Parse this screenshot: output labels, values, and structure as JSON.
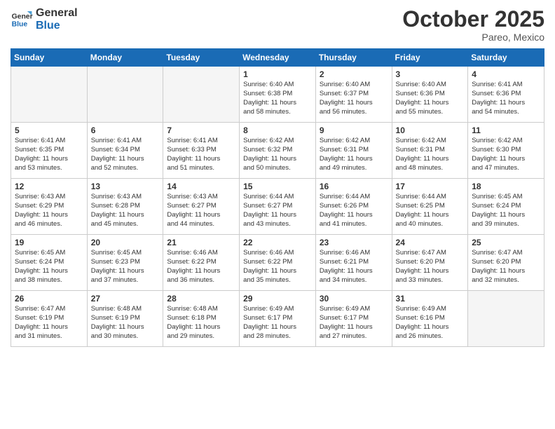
{
  "header": {
    "logo_general": "General",
    "logo_blue": "Blue",
    "month_title": "October 2025",
    "location": "Pareo, Mexico"
  },
  "weekdays": [
    "Sunday",
    "Monday",
    "Tuesday",
    "Wednesday",
    "Thursday",
    "Friday",
    "Saturday"
  ],
  "weeks": [
    [
      {
        "day": "",
        "info": ""
      },
      {
        "day": "",
        "info": ""
      },
      {
        "day": "",
        "info": ""
      },
      {
        "day": "1",
        "info": "Sunrise: 6:40 AM\nSunset: 6:38 PM\nDaylight: 11 hours\nand 58 minutes."
      },
      {
        "day": "2",
        "info": "Sunrise: 6:40 AM\nSunset: 6:37 PM\nDaylight: 11 hours\nand 56 minutes."
      },
      {
        "day": "3",
        "info": "Sunrise: 6:40 AM\nSunset: 6:36 PM\nDaylight: 11 hours\nand 55 minutes."
      },
      {
        "day": "4",
        "info": "Sunrise: 6:41 AM\nSunset: 6:36 PM\nDaylight: 11 hours\nand 54 minutes."
      }
    ],
    [
      {
        "day": "5",
        "info": "Sunrise: 6:41 AM\nSunset: 6:35 PM\nDaylight: 11 hours\nand 53 minutes."
      },
      {
        "day": "6",
        "info": "Sunrise: 6:41 AM\nSunset: 6:34 PM\nDaylight: 11 hours\nand 52 minutes."
      },
      {
        "day": "7",
        "info": "Sunrise: 6:41 AM\nSunset: 6:33 PM\nDaylight: 11 hours\nand 51 minutes."
      },
      {
        "day": "8",
        "info": "Sunrise: 6:42 AM\nSunset: 6:32 PM\nDaylight: 11 hours\nand 50 minutes."
      },
      {
        "day": "9",
        "info": "Sunrise: 6:42 AM\nSunset: 6:31 PM\nDaylight: 11 hours\nand 49 minutes."
      },
      {
        "day": "10",
        "info": "Sunrise: 6:42 AM\nSunset: 6:31 PM\nDaylight: 11 hours\nand 48 minutes."
      },
      {
        "day": "11",
        "info": "Sunrise: 6:42 AM\nSunset: 6:30 PM\nDaylight: 11 hours\nand 47 minutes."
      }
    ],
    [
      {
        "day": "12",
        "info": "Sunrise: 6:43 AM\nSunset: 6:29 PM\nDaylight: 11 hours\nand 46 minutes."
      },
      {
        "day": "13",
        "info": "Sunrise: 6:43 AM\nSunset: 6:28 PM\nDaylight: 11 hours\nand 45 minutes."
      },
      {
        "day": "14",
        "info": "Sunrise: 6:43 AM\nSunset: 6:27 PM\nDaylight: 11 hours\nand 44 minutes."
      },
      {
        "day": "15",
        "info": "Sunrise: 6:44 AM\nSunset: 6:27 PM\nDaylight: 11 hours\nand 43 minutes."
      },
      {
        "day": "16",
        "info": "Sunrise: 6:44 AM\nSunset: 6:26 PM\nDaylight: 11 hours\nand 41 minutes."
      },
      {
        "day": "17",
        "info": "Sunrise: 6:44 AM\nSunset: 6:25 PM\nDaylight: 11 hours\nand 40 minutes."
      },
      {
        "day": "18",
        "info": "Sunrise: 6:45 AM\nSunset: 6:24 PM\nDaylight: 11 hours\nand 39 minutes."
      }
    ],
    [
      {
        "day": "19",
        "info": "Sunrise: 6:45 AM\nSunset: 6:24 PM\nDaylight: 11 hours\nand 38 minutes."
      },
      {
        "day": "20",
        "info": "Sunrise: 6:45 AM\nSunset: 6:23 PM\nDaylight: 11 hours\nand 37 minutes."
      },
      {
        "day": "21",
        "info": "Sunrise: 6:46 AM\nSunset: 6:22 PM\nDaylight: 11 hours\nand 36 minutes."
      },
      {
        "day": "22",
        "info": "Sunrise: 6:46 AM\nSunset: 6:22 PM\nDaylight: 11 hours\nand 35 minutes."
      },
      {
        "day": "23",
        "info": "Sunrise: 6:46 AM\nSunset: 6:21 PM\nDaylight: 11 hours\nand 34 minutes."
      },
      {
        "day": "24",
        "info": "Sunrise: 6:47 AM\nSunset: 6:20 PM\nDaylight: 11 hours\nand 33 minutes."
      },
      {
        "day": "25",
        "info": "Sunrise: 6:47 AM\nSunset: 6:20 PM\nDaylight: 11 hours\nand 32 minutes."
      }
    ],
    [
      {
        "day": "26",
        "info": "Sunrise: 6:47 AM\nSunset: 6:19 PM\nDaylight: 11 hours\nand 31 minutes."
      },
      {
        "day": "27",
        "info": "Sunrise: 6:48 AM\nSunset: 6:19 PM\nDaylight: 11 hours\nand 30 minutes."
      },
      {
        "day": "28",
        "info": "Sunrise: 6:48 AM\nSunset: 6:18 PM\nDaylight: 11 hours\nand 29 minutes."
      },
      {
        "day": "29",
        "info": "Sunrise: 6:49 AM\nSunset: 6:17 PM\nDaylight: 11 hours\nand 28 minutes."
      },
      {
        "day": "30",
        "info": "Sunrise: 6:49 AM\nSunset: 6:17 PM\nDaylight: 11 hours\nand 27 minutes."
      },
      {
        "day": "31",
        "info": "Sunrise: 6:49 AM\nSunset: 6:16 PM\nDaylight: 11 hours\nand 26 minutes."
      },
      {
        "day": "",
        "info": ""
      }
    ]
  ]
}
